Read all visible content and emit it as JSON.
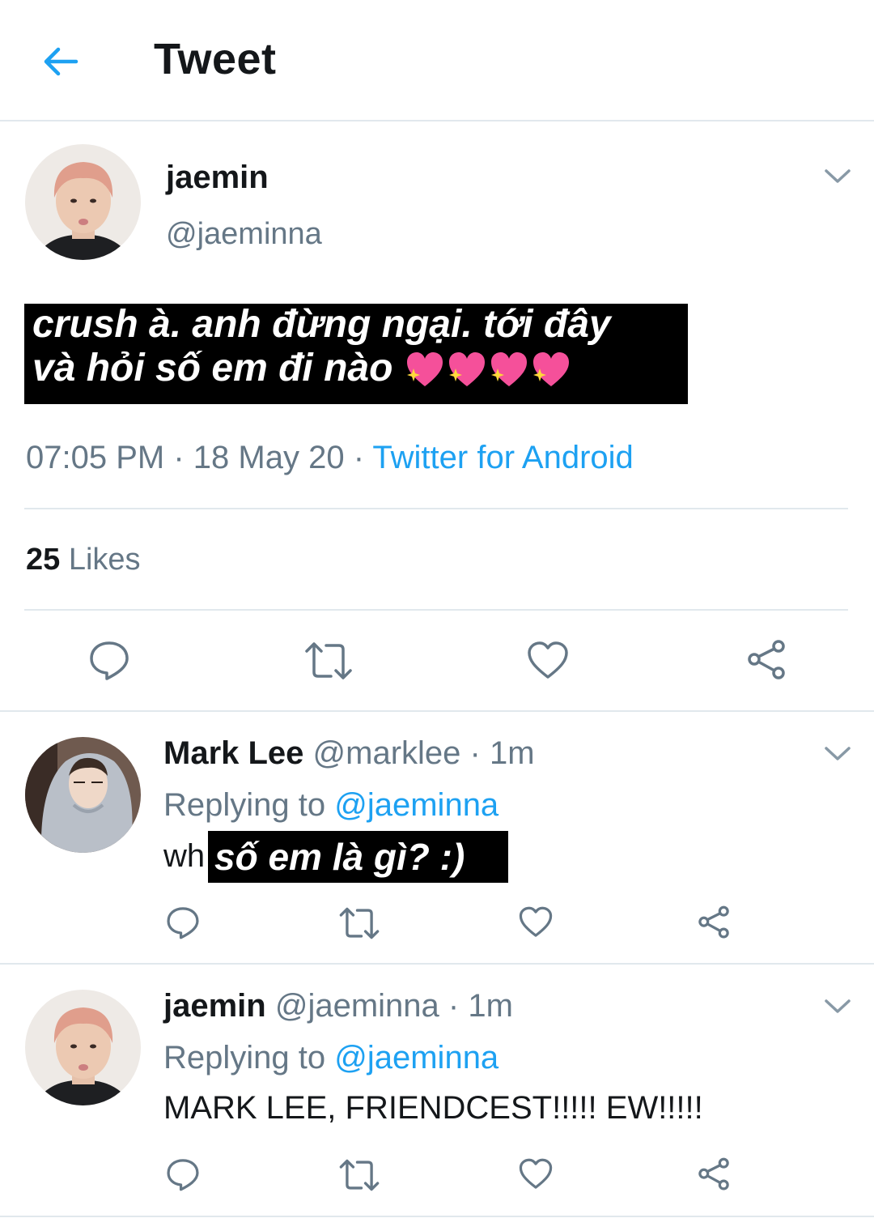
{
  "header": {
    "title": "Tweet"
  },
  "main_tweet": {
    "name": "jaemin",
    "handle": "@jaeminna",
    "caption_line1": "crush à. anh đừng ngại. tới đây",
    "caption_line2": "và hỏi số em đi nào",
    "time": "07:05 PM",
    "date": "18 May 20",
    "separator": "·",
    "source": "Twitter for Android",
    "likes_count": "25",
    "likes_label": "Likes"
  },
  "replies": [
    {
      "name": "Mark Lee",
      "handle": "@marklee",
      "time": "· 1m",
      "replying_label": "Replying to",
      "replying_to": "@jaeminna",
      "text_prefix": "wh",
      "overlay_text": "số em là gì? :)"
    },
    {
      "name": "jaemin",
      "handle": "@jaeminna",
      "time": "· 1m",
      "replying_label": "Replying to",
      "replying_to": "@jaeminna",
      "text": "MARK LEE, FRIENDCEST!!!!! EW!!!!!"
    }
  ],
  "colors": {
    "accent": "#1da1f2",
    "muted": "#657786",
    "divider": "#e1e8ed",
    "text": "#14171a"
  }
}
